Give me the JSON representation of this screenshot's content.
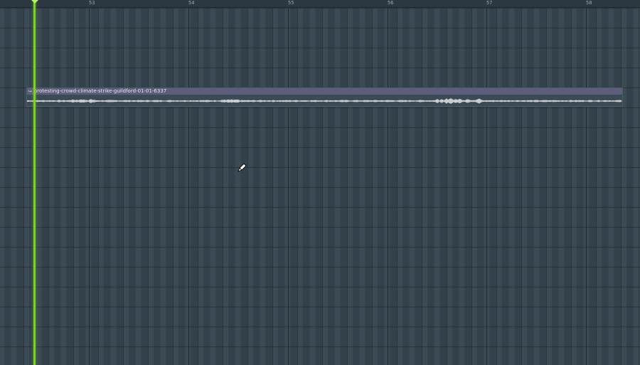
{
  "ruler": {
    "bar_numbers": [
      "53",
      "54",
      "55",
      "56",
      "57",
      "58"
    ]
  },
  "clip": {
    "name": "protesting-crowd-climate-strike-guildford-01-01-6337"
  },
  "colors": {
    "background": "#34444e",
    "playhead": "#7ed321",
    "clip_header": "#5c5e7c",
    "waveform": "#c9cdd2"
  },
  "icons": {
    "playhead_marker": "triangle-down-icon",
    "clip_flag": "clip-flag-icon",
    "cursor": "pencil-cursor-icon"
  }
}
